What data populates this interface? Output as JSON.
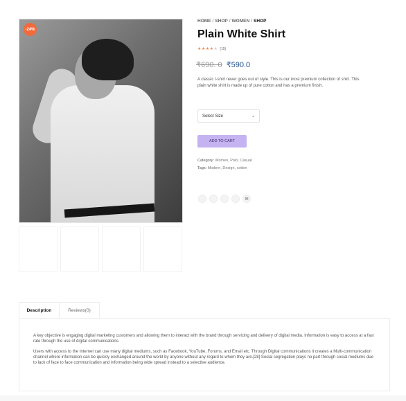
{
  "product": {
    "badge": "-24%",
    "breadcrumb": {
      "home": "HOME",
      "shop": "SHOP",
      "women": "WOMEN",
      "current": "SHOP",
      "separator": "/"
    },
    "title": "Plain White Shirt",
    "rating": {
      "stars_filled": 4,
      "stars_total": 5,
      "count_text": "(15)"
    },
    "old_price": "₹690. 0",
    "new_price": "₹590.0",
    "description": "A classic t-shirt never goes out of style. This is our most premium collection of shirt. This plain white shirt is made up of pure cotton and has a premium finish.",
    "size_select": {
      "selected": "Select Size",
      "icon": "chevron-down-icon"
    },
    "add_to_cart": "ADD TO CART",
    "category": {
      "label": "Category:",
      "value": "Women, Polo, Casual"
    },
    "tags": {
      "label": "Tags:",
      "value": "Modern, Design, cotton"
    },
    "share_icons": [
      "facebook-icon",
      "twitter-icon",
      "pinterest-icon",
      "linkedin-icon",
      "email-icon"
    ]
  },
  "tabs": [
    {
      "label": "Description",
      "active": true
    },
    {
      "label": "Reviews(0)",
      "active": false
    }
  ],
  "description_panel": {
    "paragraphs": [
      "A key objective is engaging digital marketing customers and allowing them to interact with the brand through servicing and delivery of digital media. Information is easy to access at a fast rate through the use of digital communications.",
      "Users with access to the Internet can use many digital mediums, such as Facebook, YouTube, Forums, and Email etc. Through Digital communications it creates a Multi-communication channel where information can be quickly exchanged around the world by anyone without any regard to whom they are.[28] Social segregation plays no part through social mediums due to lack of face to face communication and information being wide spread instead to a selective audience."
    ]
  },
  "colors": {
    "badge": "#f26a3b",
    "accent_button": "#c4b3f0",
    "price": "#1f4f8a",
    "star": "#e98a4e"
  }
}
